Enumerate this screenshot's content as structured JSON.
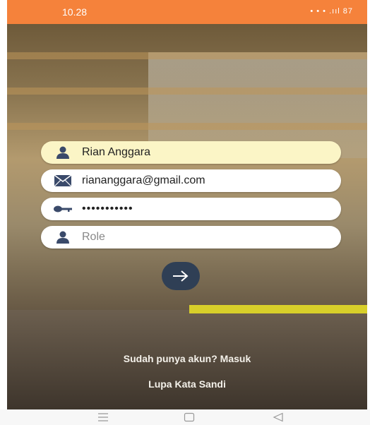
{
  "status_bar": {
    "time": "10.28",
    "indicators": "• • • .ııl 87"
  },
  "form": {
    "name_value": "Rian Anggara",
    "email_value": "riananggara@gmail.com",
    "password_mask": "•••••••••••",
    "role_placeholder": "Role"
  },
  "links": {
    "login": "Sudah punya akun? Masuk",
    "forgot": "Lupa Kata Sandi"
  },
  "colors": {
    "status": "#f5823b",
    "button": "#2f3f55",
    "field_highlight": "#fbf5c6",
    "icon": "#3a4a6a"
  },
  "icons": {
    "name": "person-icon",
    "email": "mail-icon",
    "password": "key-icon",
    "role": "person-icon",
    "submit": "arrow-right-icon"
  }
}
